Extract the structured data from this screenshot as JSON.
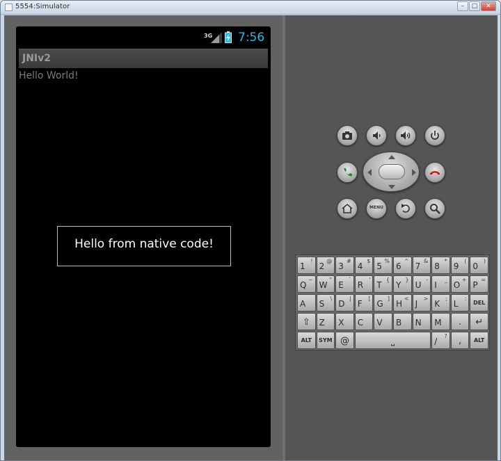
{
  "window": {
    "title": "5554:Simulator"
  },
  "window_controls": {
    "minimize": "–",
    "maximize": "□",
    "close": "✕"
  },
  "status_bar": {
    "network": "3G",
    "time": "7:56",
    "colors": {
      "time": "#33b5e5"
    }
  },
  "app": {
    "title": "JNIv2",
    "body_text": "Hello World!",
    "toast": "Hello from native code!"
  },
  "controls": {
    "menu_label": "MENU",
    "top_row": [
      "camera-icon",
      "volume-down-icon",
      "volume-up-icon",
      "power-icon"
    ],
    "middle_row": [
      "call-icon",
      "dpad",
      "end-call-icon"
    ],
    "bottom_row": [
      "home-icon",
      "menu-button",
      "back-icon",
      "search-icon"
    ]
  },
  "keyboard": {
    "row1": [
      {
        "main": "1",
        "alt": "!"
      },
      {
        "main": "2",
        "alt": "@"
      },
      {
        "main": "3",
        "alt": "#"
      },
      {
        "main": "4",
        "alt": "$"
      },
      {
        "main": "5",
        "alt": "%"
      },
      {
        "main": "6",
        "alt": "^"
      },
      {
        "main": "7",
        "alt": "&"
      },
      {
        "main": "8",
        "alt": "*"
      },
      {
        "main": "9",
        "alt": "("
      },
      {
        "main": "0",
        "alt": ")"
      }
    ],
    "row2": [
      {
        "main": "Q",
        "alt": "~"
      },
      {
        "main": "W",
        "alt": "\""
      },
      {
        "main": "E",
        "alt": "`"
      },
      {
        "main": "R",
        "alt": "'"
      },
      {
        "main": "T",
        "alt": "{"
      },
      {
        "main": "Y",
        "alt": "}"
      },
      {
        "main": "U",
        "alt": "-"
      },
      {
        "main": "I",
        "alt": "_"
      },
      {
        "main": "O",
        "alt": "+"
      },
      {
        "main": "P",
        "alt": "="
      }
    ],
    "row3": [
      {
        "main": "A",
        "alt": ""
      },
      {
        "main": "S",
        "alt": "\\"
      },
      {
        "main": "D",
        "alt": "|"
      },
      {
        "main": "F",
        "alt": "["
      },
      {
        "main": "G",
        "alt": "]"
      },
      {
        "main": "H",
        "alt": "<"
      },
      {
        "main": "J",
        "alt": ">"
      },
      {
        "main": "K",
        "alt": ";"
      },
      {
        "main": "L",
        "alt": ":"
      },
      {
        "main": "DEL",
        "alt": ""
      }
    ],
    "row4": [
      {
        "main": "⇧",
        "alt": ""
      },
      {
        "main": "Z",
        "alt": ""
      },
      {
        "main": "X",
        "alt": ""
      },
      {
        "main": "C",
        "alt": ""
      },
      {
        "main": "V",
        "alt": ""
      },
      {
        "main": "B",
        "alt": ""
      },
      {
        "main": "N",
        "alt": ""
      },
      {
        "main": "M",
        "alt": ""
      },
      {
        "main": ".",
        "alt": ""
      },
      {
        "main": "↵",
        "alt": ""
      }
    ],
    "row5": [
      {
        "main": "ALT"
      },
      {
        "main": "SYM"
      },
      {
        "main": "@"
      },
      {
        "main": "⎵"
      },
      {
        "main": "/",
        "alt": "?"
      },
      {
        "main": ",",
        "alt": ""
      },
      {
        "main": "ALT"
      }
    ]
  }
}
